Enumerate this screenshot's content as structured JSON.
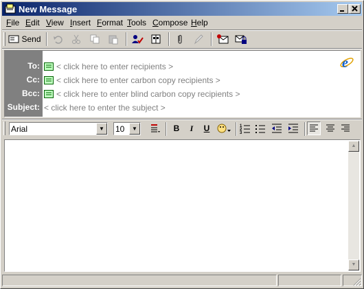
{
  "window": {
    "title": "New Message"
  },
  "menu": [
    {
      "label": "File",
      "key": "F",
      "rest": "ile"
    },
    {
      "label": "Edit",
      "key": "E",
      "rest": "dit"
    },
    {
      "label": "View",
      "key": "V",
      "rest": "iew"
    },
    {
      "label": "Insert",
      "key": "I",
      "rest": "nsert"
    },
    {
      "label": "Format",
      "key": "F",
      "rest": "ormat"
    },
    {
      "label": "Tools",
      "key": "T",
      "rest": "ools"
    },
    {
      "label": "Compose",
      "key": "C",
      "rest": "ompose"
    },
    {
      "label": "Help",
      "key": "H",
      "rest": "elp"
    }
  ],
  "toolbar": {
    "send_label": "Send"
  },
  "headers": {
    "to": {
      "label": "To:",
      "placeholder": "< click here to enter recipients >"
    },
    "cc": {
      "label": "Cc:",
      "placeholder": "< click here to enter carbon copy recipients >"
    },
    "bcc": {
      "label": "Bcc:",
      "placeholder": "< click here to enter blind carbon copy recipients >"
    },
    "subject": {
      "label": "Subject:",
      "placeholder": "< click here to enter the subject >"
    }
  },
  "format": {
    "font": "Arial",
    "size": "10",
    "bold": "B",
    "italic": "I",
    "underline": "U"
  },
  "colors": {
    "title_start": "#0a246a",
    "title_end": "#a6caf0",
    "face": "#d4d0c8",
    "label_bg": "#808080"
  }
}
